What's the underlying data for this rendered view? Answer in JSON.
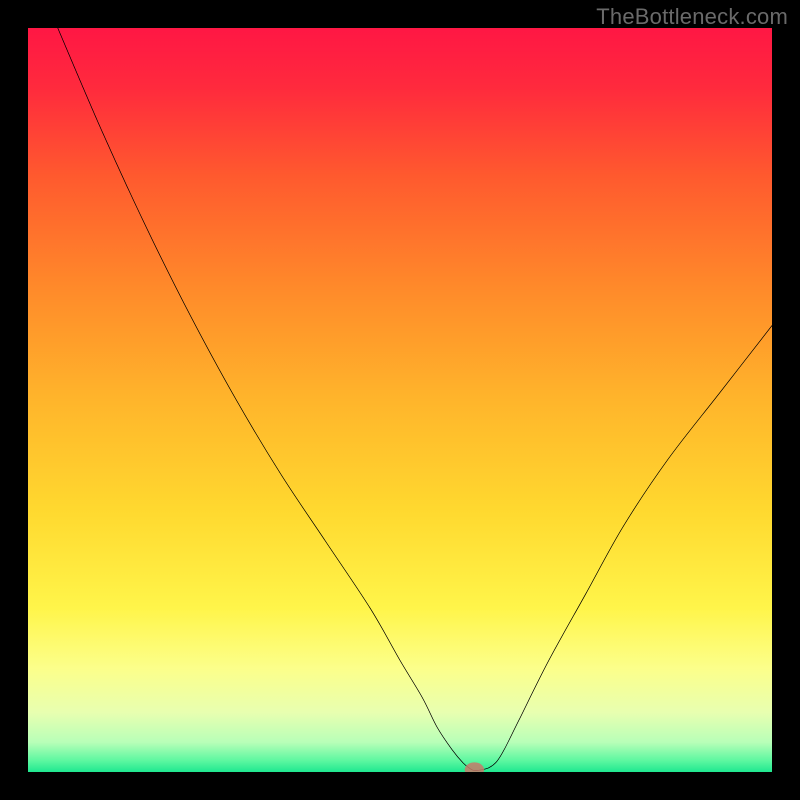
{
  "watermark": "TheBottleneck.com",
  "chart_data": {
    "type": "line",
    "title": "",
    "xlabel": "",
    "ylabel": "",
    "xlim": [
      0,
      100
    ],
    "ylim": [
      0,
      100
    ],
    "grid": false,
    "legend": false,
    "background_gradient": {
      "stops": [
        {
          "offset": 0.0,
          "color": "#ff1744"
        },
        {
          "offset": 0.08,
          "color": "#ff2a3d"
        },
        {
          "offset": 0.2,
          "color": "#ff5a2e"
        },
        {
          "offset": 0.35,
          "color": "#ff8a2a"
        },
        {
          "offset": 0.5,
          "color": "#ffb52b"
        },
        {
          "offset": 0.65,
          "color": "#ffd92f"
        },
        {
          "offset": 0.78,
          "color": "#fff54a"
        },
        {
          "offset": 0.86,
          "color": "#fcff8a"
        },
        {
          "offset": 0.92,
          "color": "#e8ffb0"
        },
        {
          "offset": 0.96,
          "color": "#b8ffb8"
        },
        {
          "offset": 0.985,
          "color": "#5cf7a0"
        },
        {
          "offset": 1.0,
          "color": "#1fe890"
        }
      ]
    },
    "series": [
      {
        "name": "bottleneck-curve",
        "color": "#000000",
        "x": [
          4,
          10,
          16,
          22,
          28,
          34,
          40,
          46,
          50,
          53,
          55,
          57,
          58.5,
          59.5,
          60,
          61,
          62,
          63,
          64,
          66,
          70,
          75,
          80,
          86,
          93,
          100
        ],
        "values": [
          100,
          86,
          73,
          61,
          50,
          40,
          31,
          22,
          15,
          10,
          6,
          3,
          1.2,
          0.4,
          0.2,
          0.3,
          0.6,
          1.4,
          3,
          7,
          15,
          24,
          33,
          42,
          51,
          60
        ]
      }
    ],
    "markers": [
      {
        "name": "optimal-point",
        "shape": "ellipse",
        "x": 60,
        "y": 0.3,
        "rx": 1.3,
        "ry": 1.0,
        "fill": "#c77a6a",
        "opacity": 0.85
      }
    ]
  }
}
